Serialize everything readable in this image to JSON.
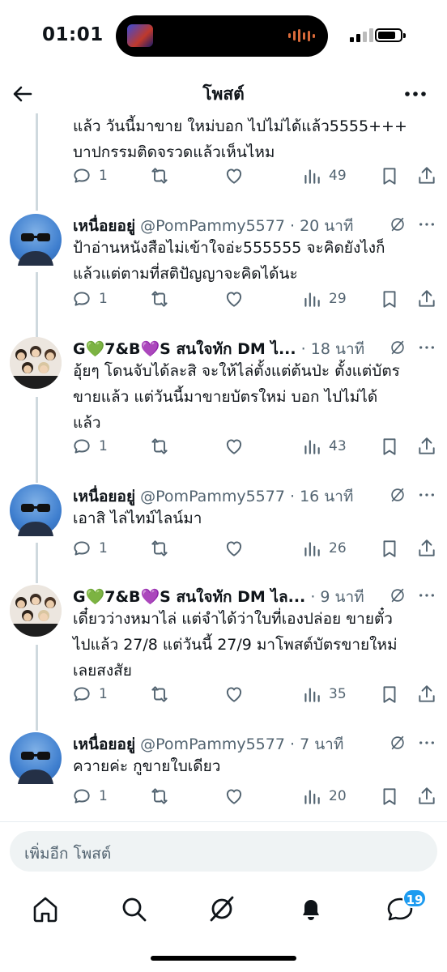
{
  "status_bar": {
    "time": "01:01"
  },
  "header": {
    "title": "โพสต์"
  },
  "top_post": {
    "text": "แล้ว วันนี้มาขาย ใหม่บอก ไปไม่ได้แล้ว5555+++\nบาปกรรมติดจรวดแล้วเห็นไหม",
    "replies": "1",
    "views": "49"
  },
  "posts": [
    {
      "name": "เหนื่อยอยู่",
      "handle": "@PomPammy5577",
      "time": "· 20 นาที",
      "text": "ป้าอ่านหนังสือไม่เข้าใจอ่ะ555555 จะคิดยังไงก็\nแล้วแต่ตามที่สติปัญญาจะคิดได้นะ",
      "replies": "1",
      "views": "29"
    },
    {
      "name": "G💚7&B💜S สนใจทัก DM ไ...",
      "handle": "",
      "time": "· 18 นาที",
      "text": "อุ้ยๆ โดนจับได้ละสิ จะให้ไล่ตั้งแต่ต้นป่ะ ตั้งแต่บัตร\nขายแล้ว แต่วันนี้มาขายบัตรใหม่ บอก ไปไม่ได้\nแล้ว",
      "replies": "1",
      "views": "43"
    },
    {
      "name": "เหนื่อยอยู่",
      "handle": "@PomPammy5577",
      "time": "· 16 นาที",
      "text": "เอาสิ ไล่ไทม์ไลน์มา",
      "replies": "1",
      "views": "26"
    },
    {
      "name": "G💚7&B💜S สนใจทัก DM ไล...",
      "handle": "",
      "time": "· 9 นาที",
      "text": "เดี๋ยวว่างหมาไล่ แต่จำได้ว่าใบที่เองปล่อย ขายตั๋ว\nไปแล้ว 27/8 แต่วันนี้ 27/9 มาโพสต์บัตรขายใหม่\nเลยสงสัย",
      "replies": "1",
      "views": "35"
    },
    {
      "name": "เหนื่อยอยู่",
      "handle": "@PomPammy5577",
      "time": "· 7 นาที",
      "text": "ควายค่ะ กูขายใบเดียว",
      "replies": "1",
      "views": "20"
    }
  ],
  "composer": {
    "placeholder": "เพิ่มอีก โพสต์"
  },
  "tabbar": {
    "messages_badge": "19"
  },
  "colors": {
    "accent": "#1d9bf0",
    "muted": "#536471",
    "thread_line": "#cfd9de"
  }
}
